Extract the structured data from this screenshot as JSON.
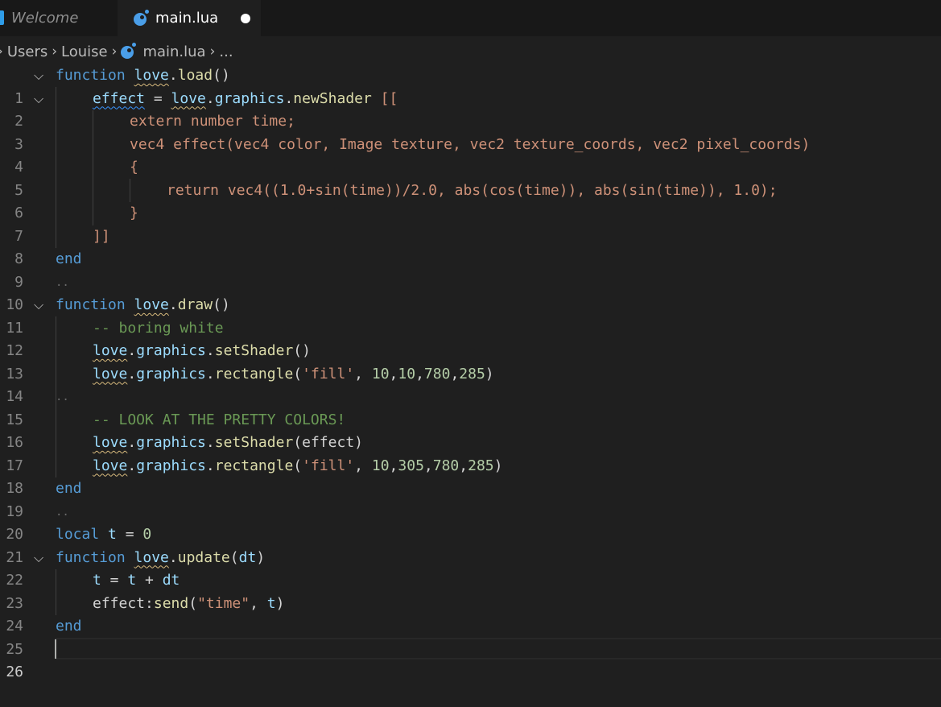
{
  "tabs": [
    {
      "label": "Welcome",
      "active": false
    },
    {
      "label": "main.lua",
      "active": true,
      "dirty": true
    }
  ],
  "breadcrumb": {
    "items": [
      "Users",
      "Louise"
    ],
    "file": "main.lua",
    "more": "..."
  },
  "editor": {
    "line_numbers": [
      "1",
      "2",
      "3",
      "4",
      "5",
      "6",
      "7",
      "8",
      "9",
      "10",
      "11",
      "12",
      "13",
      "14",
      "15",
      "16",
      "17",
      "18",
      "19",
      "20",
      "21",
      "22",
      "23",
      "24",
      "25",
      "26"
    ],
    "current_line": "26",
    "lines": {
      "l1": {
        "t1": "function",
        "t2": "love",
        "t3": ".",
        "t4": "load",
        "t5": "()"
      },
      "l2": {
        "t1": "effect",
        "t2": " = ",
        "t3": "love",
        "t4": ".",
        "t5": "graphics",
        "t6": ".",
        "t7": "newShader",
        "t8": " [["
      },
      "l3": {
        "t1": "extern number time;"
      },
      "l4": {
        "t1": "vec4 effect(vec4 color, Image texture, vec2 texture_coords, vec2 pixel_coords)"
      },
      "l5": {
        "t1": "{"
      },
      "l6": {
        "t1": "return vec4((1.0+sin(time))/2.0, abs(cos(time)), abs(sin(time)), 1.0);"
      },
      "l7": {
        "t1": "}"
      },
      "l8": {
        "t1": "]]"
      },
      "l9": {
        "t1": "end"
      },
      "l11": {
        "t1": "function",
        "t2": "love",
        "t3": ".",
        "t4": "draw",
        "t5": "()"
      },
      "l12": {
        "t1": "-- boring white"
      },
      "l13": {
        "t1": "love",
        "t2": ".",
        "t3": "graphics",
        "t4": ".",
        "t5": "setShader",
        "t6": "()"
      },
      "l14": {
        "t1": "love",
        "t2": ".",
        "t3": "graphics",
        "t4": ".",
        "t5": "rectangle",
        "t6": "(",
        "t7": "'fill'",
        "t8": ", ",
        "t9": "10",
        "t10": ",",
        "t11": "10",
        "t12": ",",
        "t13": "780",
        "t14": ",",
        "t15": "285",
        "t16": ")"
      },
      "l16": {
        "t1": "-- LOOK AT THE PRETTY COLORS!"
      },
      "l17": {
        "t1": "love",
        "t2": ".",
        "t3": "graphics",
        "t4": ".",
        "t5": "setShader",
        "t6": "(effect)"
      },
      "l18": {
        "t1": "love",
        "t2": ".",
        "t3": "graphics",
        "t4": ".",
        "t5": "rectangle",
        "t6": "(",
        "t7": "'fill'",
        "t8": ", ",
        "t9": "10",
        "t10": ",",
        "t11": "305",
        "t12": ",",
        "t13": "780",
        "t14": ",",
        "t15": "285",
        "t16": ")"
      },
      "l19": {
        "t1": "end"
      },
      "l21": {
        "t1": "local",
        "t2": " ",
        "t3": "t",
        "t4": " = ",
        "t5": "0"
      },
      "l22": {
        "t1": "function",
        "t2": "love",
        "t3": ".",
        "t4": "update",
        "t5": "(",
        "t6": "dt",
        "t7": ")"
      },
      "l23": {
        "t1": "t",
        "t2": " = ",
        "t3": "t",
        "t4": " + ",
        "t5": "dt"
      },
      "l24": {
        "t1": "effect",
        "t2": ":",
        "t3": "send",
        "t4": "(",
        "t5": "\"time\"",
        "t6": ", ",
        "t7": "t",
        "t8": ")"
      },
      "l25": {
        "t1": "end"
      }
    }
  },
  "colors": {
    "keyword": "#569cd6",
    "function": "#dcdcaa",
    "variable": "#9cdcfe",
    "string": "#ce9178",
    "number": "#b5cea8",
    "comment": "#6a9955",
    "background": "#1f1f1f"
  },
  "icons": {
    "lua_file": "lua-file-icon",
    "fold": "chevron-down-icon",
    "breadcrumb_sep": "chevron-right-icon"
  }
}
